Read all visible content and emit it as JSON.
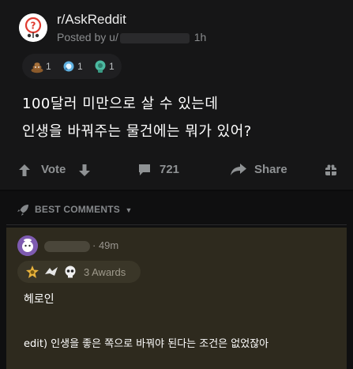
{
  "post": {
    "subreddit": "r/AskReddit",
    "posted_by_prefix": "Posted by u/",
    "time": "1h",
    "awards": [
      {
        "icon": "poop-award-icon",
        "count": "1"
      },
      {
        "icon": "wholesome-award-icon",
        "count": "1"
      },
      {
        "icon": "hugz-award-icon",
        "count": "1"
      }
    ],
    "title_line1": "100달러 미만으로 살 수 있는데",
    "title_line2": "인생을 바꿔주는 물건에는 뭐가 있어?"
  },
  "actions": {
    "vote_label": "Vote",
    "comment_count": "721",
    "share_label": "Share"
  },
  "comments_header": {
    "sort_label": "BEST COMMENTS"
  },
  "comment": {
    "time": "· 49m",
    "awards_label": "3 Awards",
    "body_line1": "헤로인",
    "body_line2": "edit) 인생을 좋은 쪽으로 바꿔야 된다는 조건은 없었잖아"
  }
}
